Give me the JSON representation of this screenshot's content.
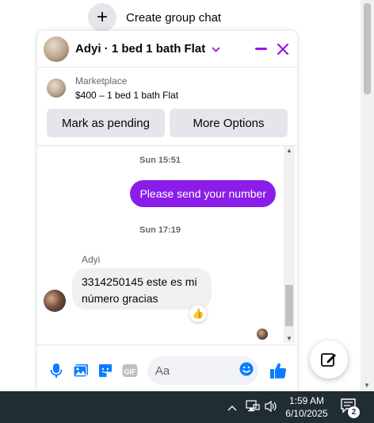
{
  "top": {
    "create_group_label": "Create group chat"
  },
  "chat": {
    "title": "Adyi · 1 bed 1 bath Flat",
    "listing": {
      "source": "Marketplace",
      "price_title": "$400 – 1 bed 1 bath Flat"
    },
    "actions": {
      "pending_label": "Mark as pending",
      "more_label": "More Options"
    },
    "messages": {
      "ts1": "Sun 15:51",
      "out1": "Please send your number",
      "ts2": "Sun 17:19",
      "sender": "Adyi",
      "in1_line1": "3314250145 este es mi",
      "in1_line2": "número gracias",
      "reaction": "👍"
    },
    "composer": {
      "placeholder": "Aa"
    }
  },
  "taskbar": {
    "time": "1:59 AM",
    "date": "6/10/2025",
    "notifications": "2"
  },
  "colors": {
    "accent": "#8a1ee8",
    "icon_blue": "#0a7cff",
    "taskbar": "#202d33"
  }
}
